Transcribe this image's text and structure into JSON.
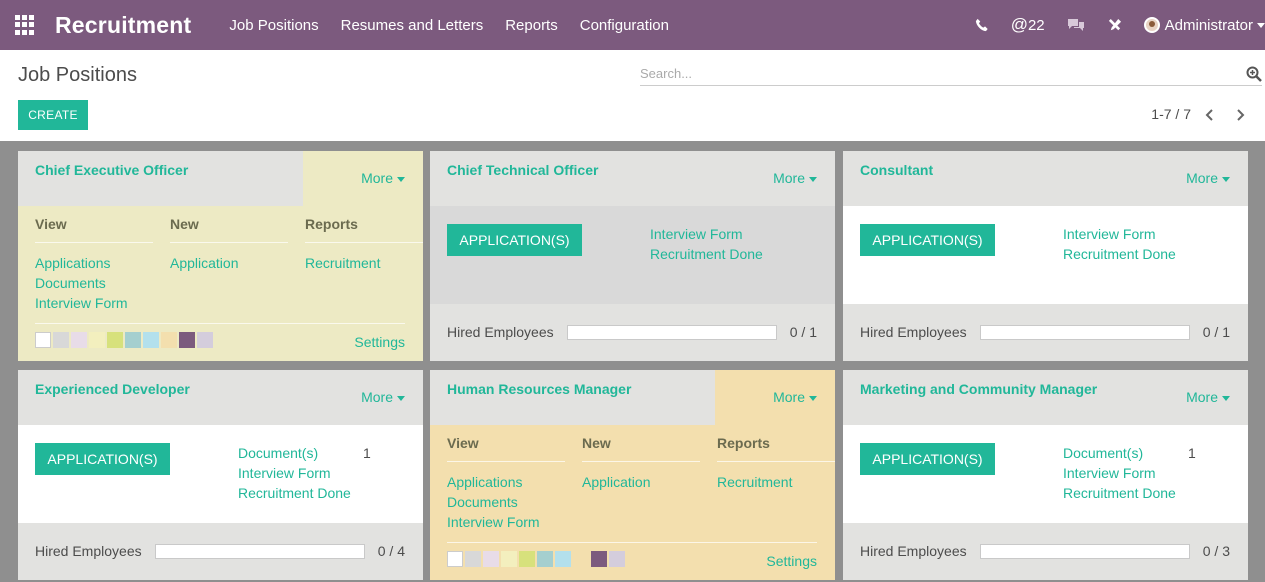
{
  "navbar": {
    "app_title": "Recruitment",
    "menu": [
      "Job Positions",
      "Resumes and Letters",
      "Reports",
      "Configuration"
    ],
    "mentions_count": "22",
    "user": "Administrator"
  },
  "control_panel": {
    "breadcrumb": "Job Positions",
    "search_placeholder": "Search...",
    "create_label": "CREATE",
    "pager": "1-7 / 7"
  },
  "kanban": {
    "more_label": "More",
    "applications_label": "APPLICATION(S)",
    "hired_label": "Hired Employees",
    "settings_label": "Settings",
    "dropdown": {
      "view_header": "View",
      "new_header": "New",
      "reports_header": "Reports",
      "view_links": [
        "Applications",
        "Documents",
        "Interview Form"
      ],
      "new_links": [
        "Application"
      ],
      "reports_links": [
        "Recruitment"
      ]
    },
    "colors": [
      "#ffffff",
      "#d8d8d8",
      "#e8dce8",
      "#f3efbe",
      "#d7e17c",
      "#a5cfcf",
      "#b3e0ec",
      "#f3dfae",
      "#7c5a7e",
      "#d4cddc"
    ],
    "cards": [
      {
        "title": "Chief Executive Officer",
        "open": true
      },
      {
        "title": "Chief Technical Officer",
        "links": [
          "Interview Form",
          "Recruitment Done"
        ],
        "hired": "0 / 1",
        "hired_ratio": 0
      },
      {
        "title": "Consultant",
        "links": [
          "Interview Form",
          "Recruitment Done"
        ],
        "hired": "0 / 1",
        "hired_ratio": 0
      },
      {
        "title": "Experienced Developer",
        "links": [
          "Document(s)",
          "Interview Form",
          "Recruitment Done"
        ],
        "doc_count": "1",
        "hired": "0 / 4",
        "hired_ratio": 0
      },
      {
        "title": "Human Resources Manager",
        "open": true
      },
      {
        "title": "Marketing and Community Manager",
        "links": [
          "Document(s)",
          "Interview Form",
          "Recruitment Done"
        ],
        "doc_count": "1",
        "hired": "0 / 3",
        "hired_ratio": 0
      }
    ]
  }
}
